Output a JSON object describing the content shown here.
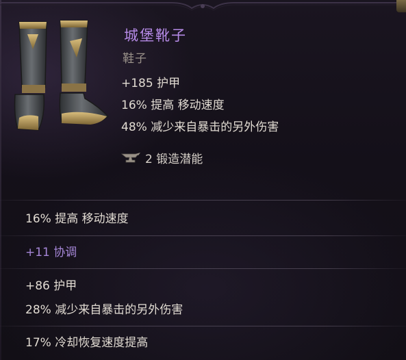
{
  "item": {
    "name": "城堡靴子",
    "type": "鞋子",
    "base_stats": [
      "+185 护甲",
      "16% 提高 移动速度",
      "48% 减少来自暴击的另外伤害"
    ],
    "forge_potential": "2 锻造潜能",
    "forge_icon": "anvil-icon",
    "image_icon": "plate-boots-icon"
  },
  "affixes": [
    {
      "text": "16% 提高 移动速度",
      "kind": "normal"
    },
    {
      "text": "+11 协调",
      "kind": "magic"
    },
    {
      "text": "+86 护甲",
      "kind": "normal"
    },
    {
      "text": "28% 减少来自暴击的另外伤害",
      "kind": "normal"
    },
    {
      "text": "17% 冷却恢复速度提高",
      "kind": "normal"
    }
  ],
  "colors": {
    "name": "#b58ae6",
    "magic_affix": "#a687d8",
    "text": "#e1dbd2",
    "muted": "#9a928a",
    "background": "#141019"
  }
}
